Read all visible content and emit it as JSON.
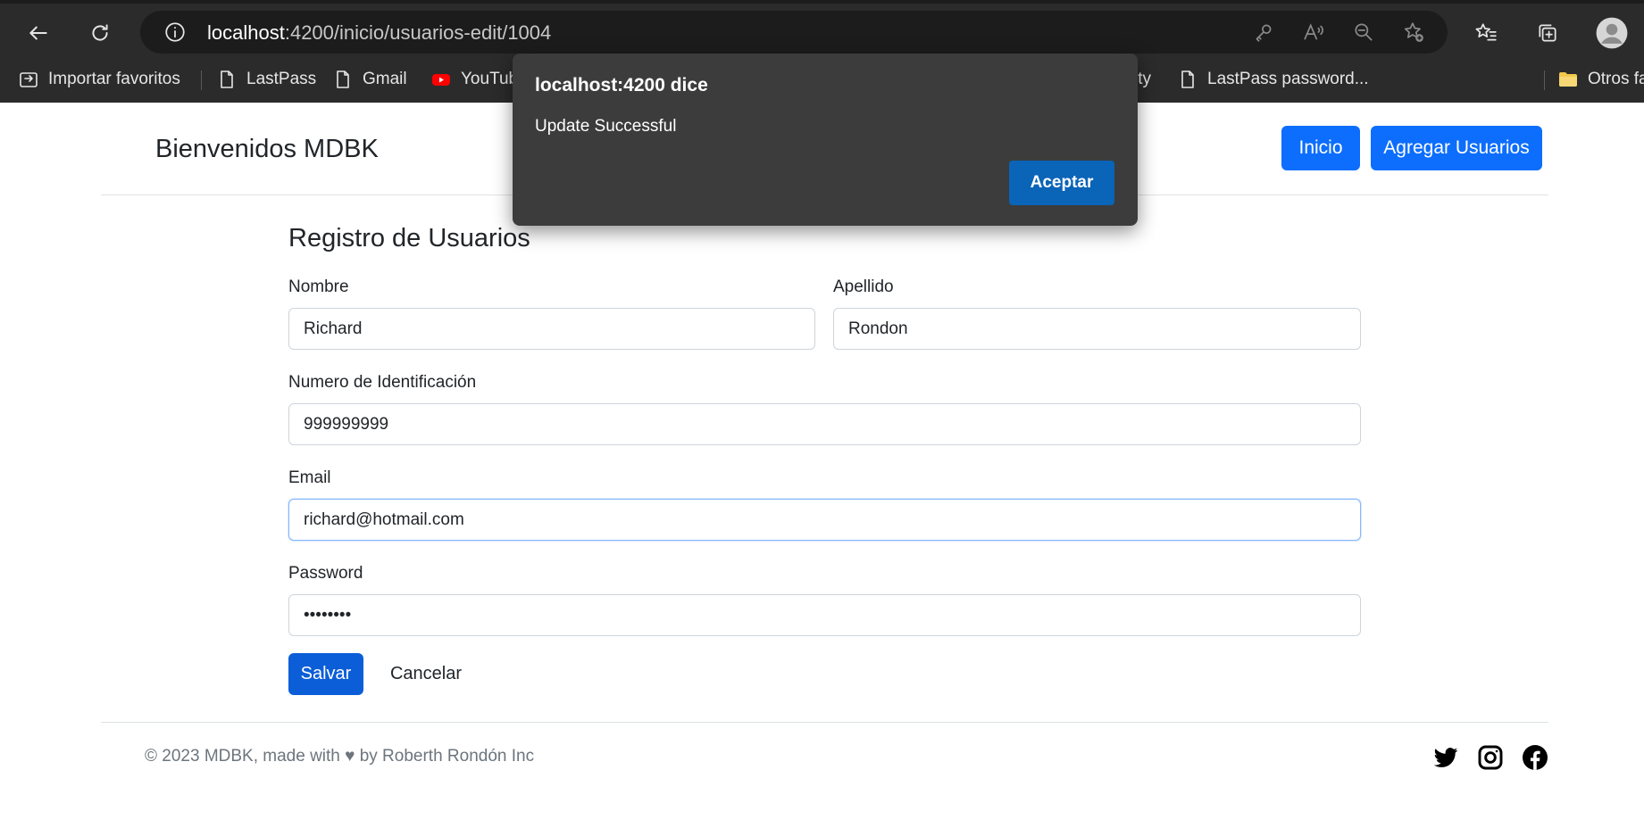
{
  "browser": {
    "url_host": "localhost",
    "url_rest": ":4200/inicio/usuarios-edit/1004",
    "bookmarks": [
      {
        "label": "Importar favoritos",
        "icon": "import-favorites-icon"
      },
      {
        "label": "LastPass",
        "icon": "page-icon"
      },
      {
        "label": "Gmail",
        "icon": "page-icon"
      },
      {
        "label": "YouTube",
        "icon": "youtube-icon"
      },
      {
        "label": "ity",
        "icon": ""
      },
      {
        "label": "LastPass password...",
        "icon": "page-icon"
      },
      {
        "label": "Otros fa",
        "icon": "folder-icon"
      }
    ]
  },
  "header": {
    "brand": "Bienvenidos MDBK",
    "nav_inicio": "Inicio",
    "nav_agregar": "Agregar Usuarios"
  },
  "form": {
    "title": "Registro de Usuarios",
    "nombre_label": "Nombre",
    "nombre_value": "Richard",
    "apellido_label": "Apellido",
    "apellido_value": "Rondon",
    "id_label": "Numero de Identificación",
    "id_value": "999999999",
    "email_label": "Email",
    "email_value": "richard@hotmail.com",
    "password_label": "Password",
    "password_value": "••••••••",
    "save_label": "Salvar",
    "cancel_label": "Cancelar"
  },
  "footer": {
    "text": "© 2023 MDBK, made with ♥ by Roberth Rondón Inc",
    "social_icons": [
      "twitter-icon",
      "instagram-icon",
      "facebook-icon"
    ]
  },
  "dialog": {
    "title": "localhost:4200 dice",
    "message": "Update Successful",
    "ok_label": "Aceptar"
  },
  "colors": {
    "primary": "#0d6efd",
    "dialog_bg": "#3c3c3c",
    "dialog_button": "#0a64b8",
    "chrome_bg": "#2b2b2b"
  }
}
